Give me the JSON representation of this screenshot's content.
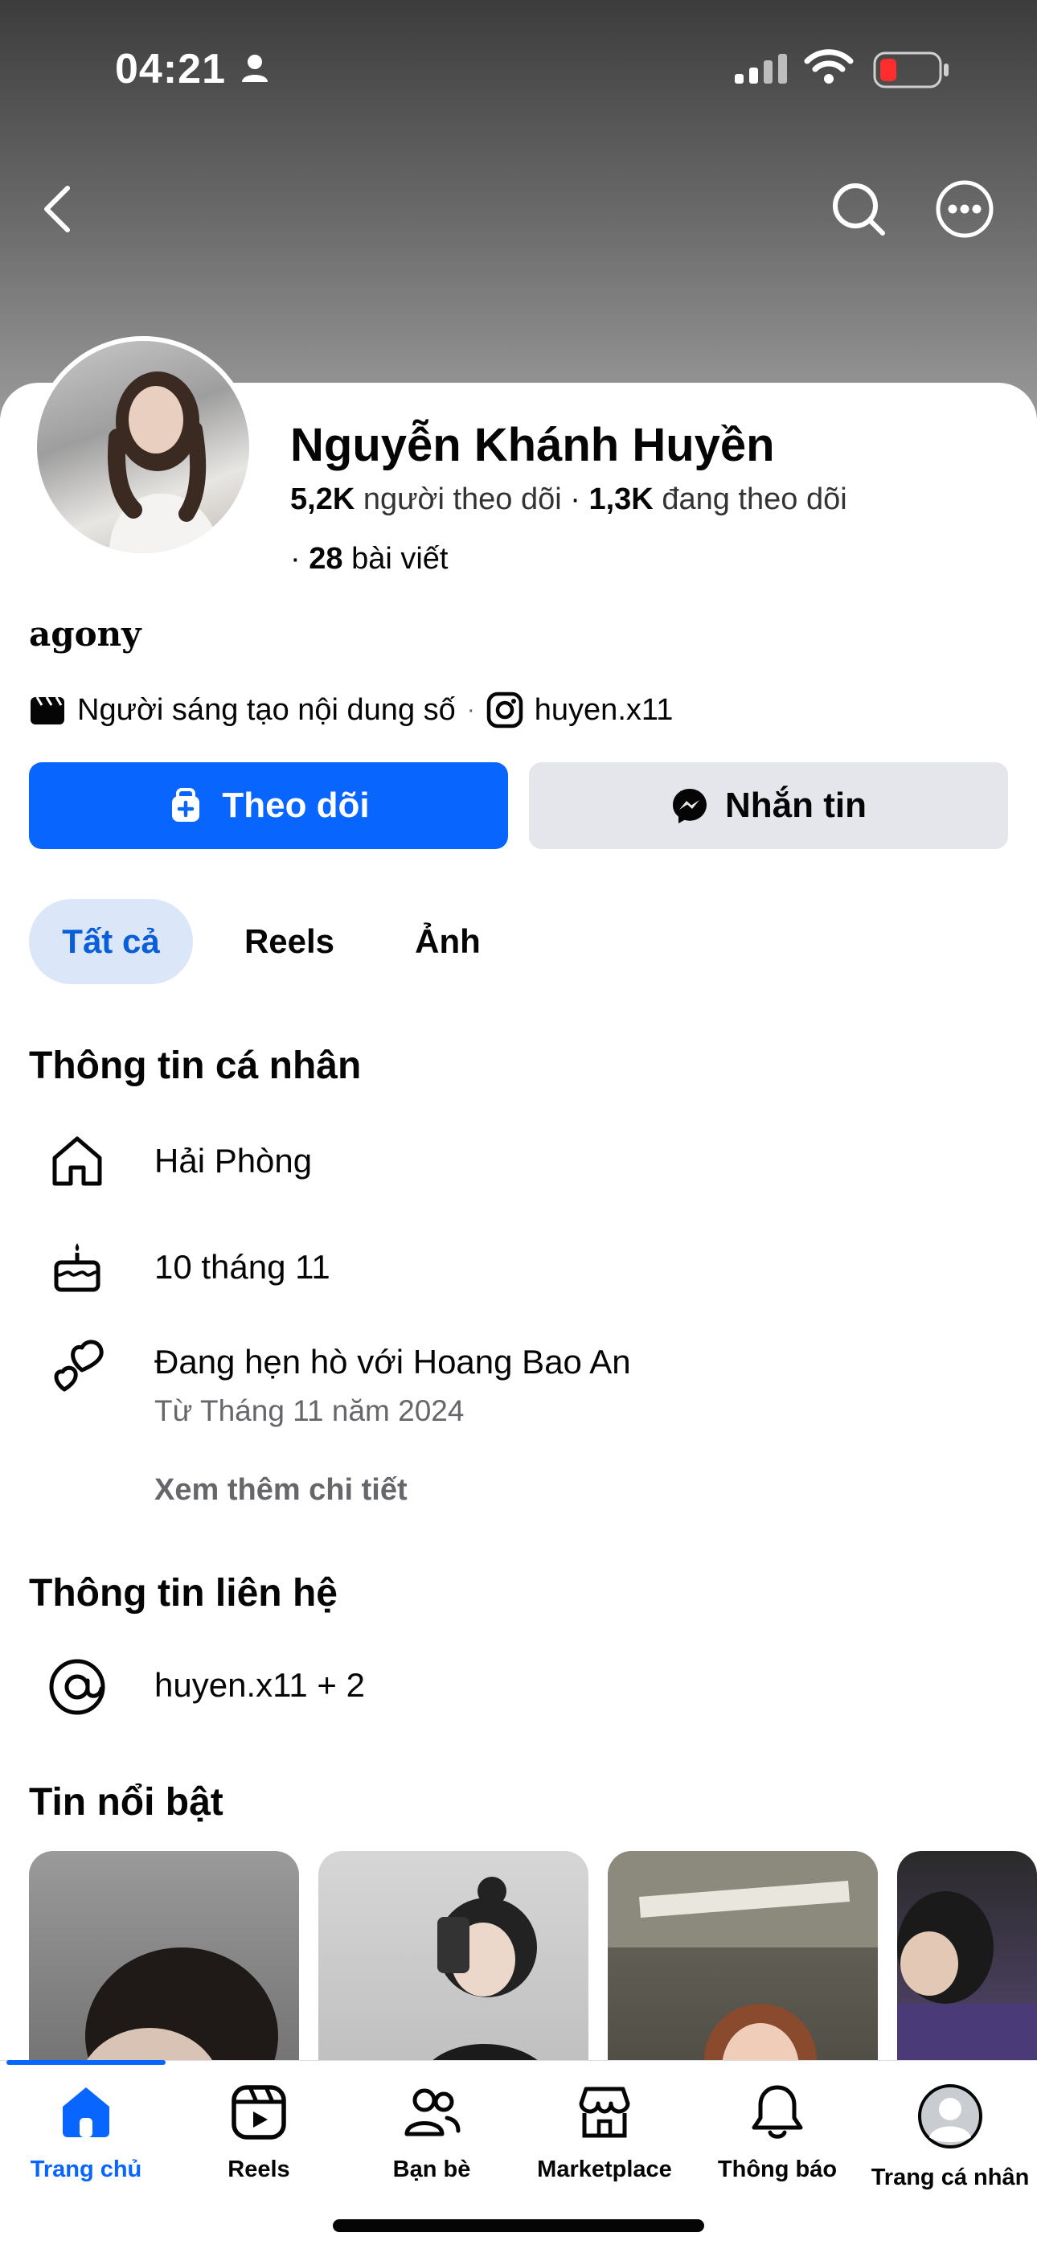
{
  "status_bar": {
    "time": "04:21"
  },
  "profile": {
    "name": "Nguyễn Khánh Huyền",
    "followers_count": "5,2K",
    "followers_label": "người theo dõi",
    "following_count": "1,3K",
    "following_label": "đang theo dõi",
    "posts_count": "28",
    "posts_label": "bài viết",
    "bio": "agony",
    "category": "Người sáng tạo nội dung số",
    "instagram": "huyen.x11"
  },
  "actions": {
    "follow_label": "Theo dõi",
    "message_label": "Nhắn tin"
  },
  "tabs": [
    {
      "label": "Tất cả",
      "active": true
    },
    {
      "label": "Reels",
      "active": false
    },
    {
      "label": "Ảnh",
      "active": false
    }
  ],
  "personal_info": {
    "title": "Thông tin cá nhân",
    "location": "Hải Phòng",
    "birthday": "10 tháng 11",
    "relationship": "Đang hẹn hò với Hoang Bao An",
    "relationship_since": "Từ Tháng 11 năm 2024",
    "see_more": "Xem thêm chi tiết"
  },
  "contact_info": {
    "title": "Thông tin liên hệ",
    "handle": "huyen.x11 + 2"
  },
  "featured": {
    "title": "Tin nổi bật"
  },
  "bottom_nav": [
    {
      "label": "Trang chủ",
      "icon": "home-icon",
      "active": true
    },
    {
      "label": "Reels",
      "icon": "reels-icon",
      "active": false
    },
    {
      "label": "Bạn bè",
      "icon": "friends-icon",
      "active": false
    },
    {
      "label": "Marketplace",
      "icon": "marketplace-icon",
      "active": false
    },
    {
      "label": "Thông báo",
      "icon": "bell-icon",
      "active": false
    },
    {
      "label": "Trang cá nhân",
      "icon": "profile-icon",
      "active": false
    }
  ],
  "colors": {
    "accent": "#0866ff",
    "tab_active_bg": "#dbe7f9",
    "secondary_button": "#e4e6eb",
    "muted_text": "#65676b"
  }
}
